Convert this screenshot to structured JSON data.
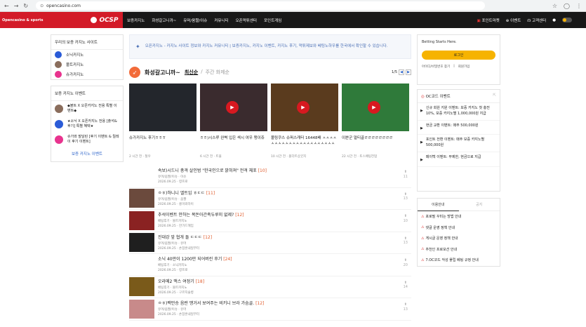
{
  "browser": {
    "url": "opencasino.com"
  },
  "header": {
    "site_label": "Opencasino & sports",
    "logo": "OCSP",
    "nav": [
      "보증카지노",
      "화성갈고니까~",
      "유머/움짤/이슈",
      "커뮤니티",
      "오픈먹튀센터",
      "포인트게임"
    ],
    "right": [
      "포인트마켓",
      "이벤트",
      "고객센터"
    ]
  },
  "left": {
    "sites_title": "우리의 보증 카지노 사이트",
    "sites": [
      {
        "label": "소닉카지노",
        "color": "#2a5bd7"
      },
      {
        "label": "볼트카지노",
        "color": "#8a6d5c"
      },
      {
        "label": "슈가카지노",
        "color": "#e8338e"
      }
    ],
    "events_title": "보증 카지노 이벤트",
    "events": [
      {
        "label": "◆볼트 X 오픈카지노 전용 특별 이벤트◆",
        "color": "#8a6d5c"
      },
      {
        "label": "★소닉 X 오픈카지노 전용 [출석&후기] 특별 혜택★",
        "color": "#2a5bd7"
      },
      {
        "label": "슈가와 말달린 [후기 이벤트 & 릴레이 후기 이벤트]",
        "color": "#e8338e"
      }
    ],
    "events_more": "보증 카지노 이벤트"
  },
  "center": {
    "notice": "오픈카지노 - 카지노 사이트 정보와 카지노 커뮤니티 | 보증카지노, 카지노 이벤트, 카지노 후기, 먹튀제보와 베팅노하우를 한국에서 확인할 수 있습니다.",
    "section_title": "화성갈고니까~",
    "tab_latest": "최신순",
    "tab_sep": "/",
    "tab_weekly": "주간 화제순",
    "page": "1/5",
    "cards": [
      {
        "title": "슈가카지노 후기ㅎㅎㅎ",
        "meta": "2 시간 전 · 철우",
        "bg": "#23262c",
        "video": false
      },
      {
        "title": "ㅎㅎ)시스루 완벽 입은 섹시 여우 맹이쥬",
        "meta": "6 시간 전 · 트울",
        "bg": "#3a2b2e",
        "video": true
      },
      {
        "title": "볼링쿠스 슈퍼스캐터 16448배 ㅅㅅㅅㅅㅅㅅㅅㅅㅅㅅㅅㅅㅅㅅㅅㅅㅅㅅㅅㅅㅅㅅㅅㅅㅅㅅㅅㅅㅅㅅ",
        "meta": "10 시간 전 · 볼더트상굿지",
        "bg": "#5a3b1e",
        "video": true
      },
      {
        "title": "이쁜군 멀티골ㄹㄹㄹㄹㄹㄹㄹㄹ",
        "meta": "22 시간 전 · 토스배팅전업",
        "bg": "#2f7a3a",
        "video": true
      }
    ],
    "posts": [
      {
        "title": "속보)시드니 총격 살인범 \"한국인으로 밝혀져\" 전격 체포",
        "count": "[10]",
        "cat": "유머/움짤/이슈 · 이슈",
        "date": "2026.09.25 · 령프로",
        "votes": "11",
        "thumb": "#ffffff"
      },
      {
        "title": "ㅇㅎ)하니니 엘트임 ㅎㄷㄷ",
        "count": "[11]",
        "cat": "유머/움짤/이슈 · 움짤",
        "date": "2026.09.25 · 롱이와하이",
        "votes": "13",
        "thumb": "#6b4a3d"
      },
      {
        "title": "추석이벤트 안하는 목돈아간족두루미 없제?",
        "count": "[12]",
        "cat": "베팅후기 · 볼트카지노",
        "date": "2026.09.25 · 한가드헤임",
        "votes": "10",
        "thumb": "#8a2222"
      },
      {
        "title": "진대강 앞 협개 돌 ㄷㄷㄷ",
        "count": "[12]",
        "cat": "유머/움짤/이슈 · 유머",
        "date": "2026.09.25 · 손잡혼내일부터",
        "votes": "13",
        "thumb": "#1f1f1f"
      },
      {
        "title": "소닉 40만이 1200만 되어버린 후기",
        "count": "[24]",
        "cat": "베팅후기 · 소닉카지노",
        "date": "2026.09.25 · 령프로",
        "votes": "20",
        "thumb": "#ffffff"
      },
      {
        "title": "오라메2 맥스 여정기",
        "count": "[18]",
        "cat": "베팅후기 · 볼트카지노",
        "date": "2026.09.25 · 구르지술병",
        "votes": "14",
        "thumb": "#7a5a1a"
      },
      {
        "title": "ㅇㅎ)백만승 음란 맹거서 보여주는 비키니 브라 가슴골.",
        "count": "[12]",
        "cat": "유머/움짤/이슈 · 유머",
        "date": "2026.09.25 · 손잡혼내일부터",
        "votes": "13",
        "thumb": "#c88a8a"
      }
    ]
  },
  "right": {
    "betting_label": "Betting Starts Here.",
    "login_button": "로그인",
    "find_link": "아이디/비밀번호 찾기",
    "sep": "|",
    "signup_link": "회원가입",
    "oc_title": "OC코드 이벤트",
    "oc_events": [
      "신규 회원 지원 이벤트: 보증 카지노 첫 충전 10%, 보증 카지노별 1,000,000원 지급",
      "현금 교환 이벤트: 매주 500,000원",
      "포인트 전환 이벤트: 매주 보증 카지노별 500,000원",
      "페이백 이벤트: 무제한, 현금으로 지급"
    ],
    "tab_guide": "이용안내",
    "tab_notice": "공지",
    "guides": [
      "포로필 꾸미는 방법 안내",
      "댓글 운영 정책 안내",
      "게시글 운영 정책 안내",
      "추천인 프로모션 안내",
      "7.OC코드 악성 플립 베팅 규정 안내"
    ]
  }
}
